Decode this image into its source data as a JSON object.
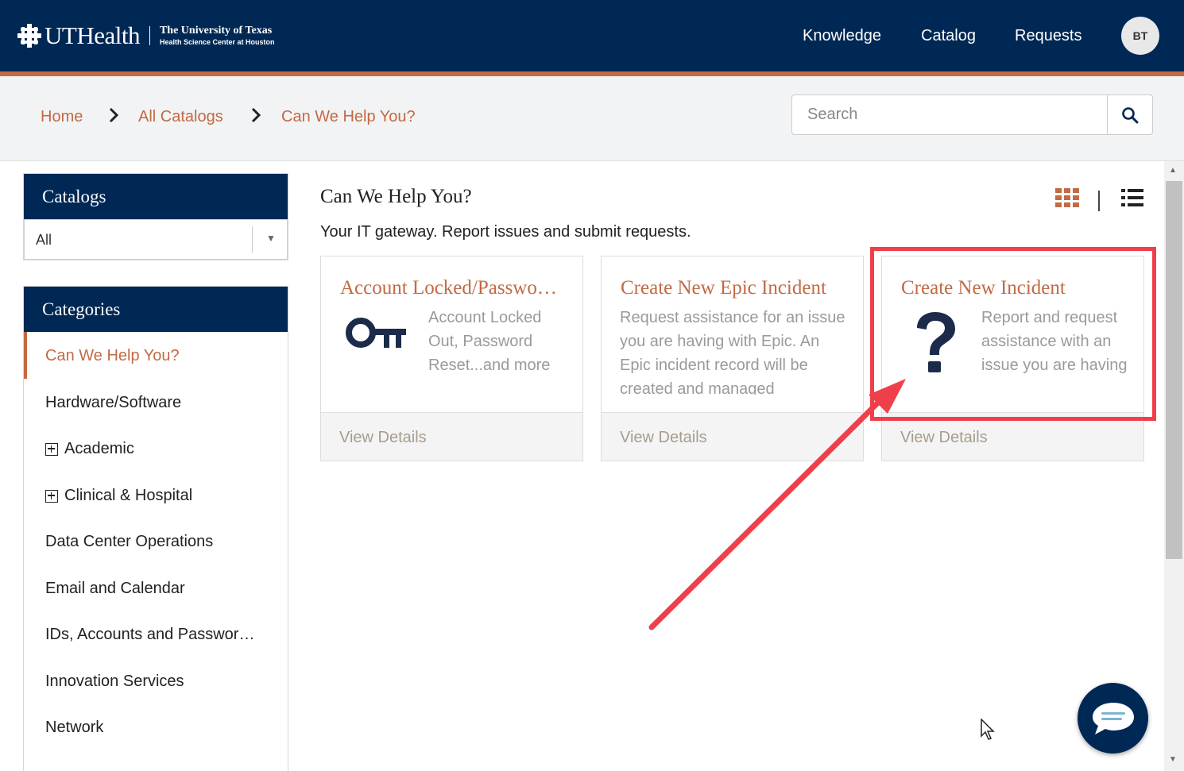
{
  "header": {
    "logo_word": "UTHealth",
    "logo_line1": "The University of Texas",
    "logo_line2": "Health Science Center at Houston",
    "nav": [
      {
        "label": "Knowledge"
      },
      {
        "label": "Catalog"
      },
      {
        "label": "Requests"
      }
    ],
    "avatar_initials": "BT",
    "colors": {
      "navy": "#002855",
      "accent": "#c26a44"
    }
  },
  "breadcrumb": {
    "items": [
      "Home",
      "All Catalogs",
      "Can We Help You?"
    ],
    "separator": ">"
  },
  "search": {
    "placeholder": "Search",
    "value": "",
    "icon": "search-icon"
  },
  "sidebar": {
    "catalogs_title": "Catalogs",
    "catalog_select_value": "All",
    "categories_title": "Categories",
    "categories": [
      {
        "label": "Can We Help You?",
        "active": true,
        "expandable": false
      },
      {
        "label": "Hardware/Software",
        "active": false,
        "expandable": false
      },
      {
        "label": "Academic",
        "active": false,
        "expandable": true
      },
      {
        "label": "Clinical & Hospital",
        "active": false,
        "expandable": true
      },
      {
        "label": "Data Center Operations",
        "active": false,
        "expandable": false
      },
      {
        "label": "Email and Calendar",
        "active": false,
        "expandable": false
      },
      {
        "label": "IDs, Accounts and Passwor…",
        "active": false,
        "expandable": false
      },
      {
        "label": "Innovation Services",
        "active": false,
        "expandable": false
      },
      {
        "label": "Network",
        "active": false,
        "expandable": false
      }
    ]
  },
  "main": {
    "title": "Can We Help You?",
    "subtitle": "Your IT gateway. Report issues and submit requests.",
    "view_modes": [
      "grid-icon",
      "list-icon"
    ],
    "cards": [
      {
        "title": "Account Locked/Passwo…",
        "description": "Account Locked Out, Password Reset...and more",
        "icon": "key-icon",
        "footer": "View Details"
      },
      {
        "title": "Create New Epic Incident",
        "description": "Request assistance for an issue you are having with Epic. An Epic incident record will be created and managed",
        "icon": "",
        "footer": "View Details"
      },
      {
        "title": "Create New Incident",
        "description": "Report and request assistance with an issue you are having",
        "icon": "question-icon",
        "footer": "View Details"
      }
    ]
  },
  "annotation": {
    "highlight_color": "#ee3f4b"
  },
  "chat": {
    "icon": "chat-icon"
  }
}
